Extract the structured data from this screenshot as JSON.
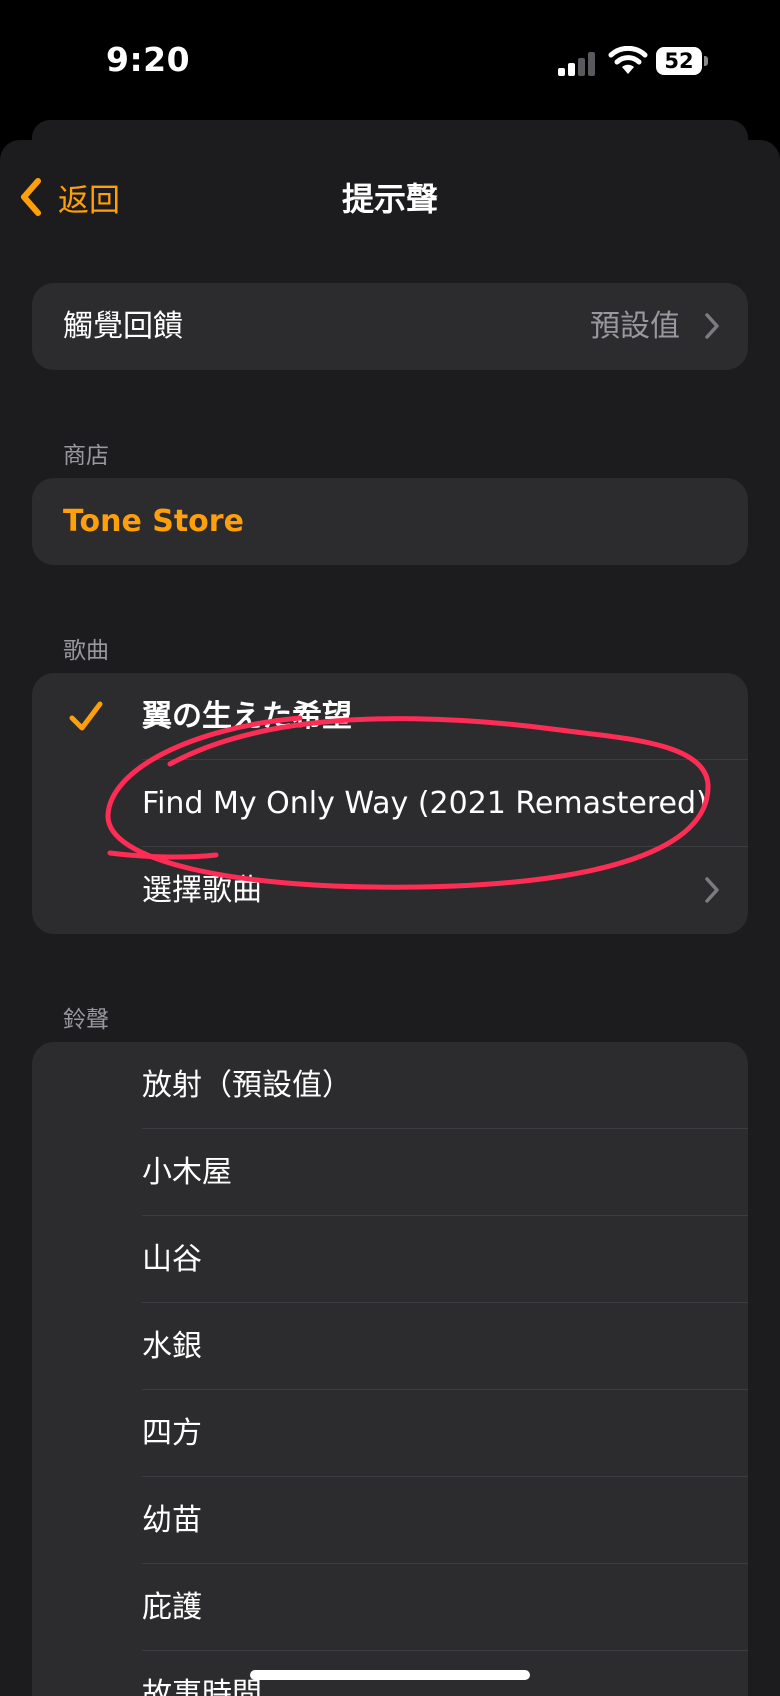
{
  "status_bar": {
    "time": "9:20",
    "battery": "52",
    "icons": [
      "signal-icon",
      "wifi-icon",
      "battery-icon"
    ]
  },
  "nav": {
    "back_label": "返回",
    "title": "提示聲"
  },
  "haptic": {
    "label": "觸覺回饋",
    "value": "預設值"
  },
  "store_section": {
    "header": "商店",
    "tone_store": "Tone Store"
  },
  "songs_section": {
    "header": "歌曲",
    "items": [
      {
        "label": "翼の生えた希望",
        "checked": true
      },
      {
        "label": "Find My Only Way (2021 Remastered)",
        "checked": false
      }
    ],
    "pick_song": "選擇歌曲"
  },
  "ringtones_section": {
    "header": "鈴聲",
    "items": [
      "放射（預設值）",
      "小木屋",
      "山谷",
      "水銀",
      "四方",
      "幼苗",
      "庇護",
      "故事時間"
    ]
  },
  "colors": {
    "accent": "#ff9f0a",
    "annotation": "#ff2d55"
  }
}
